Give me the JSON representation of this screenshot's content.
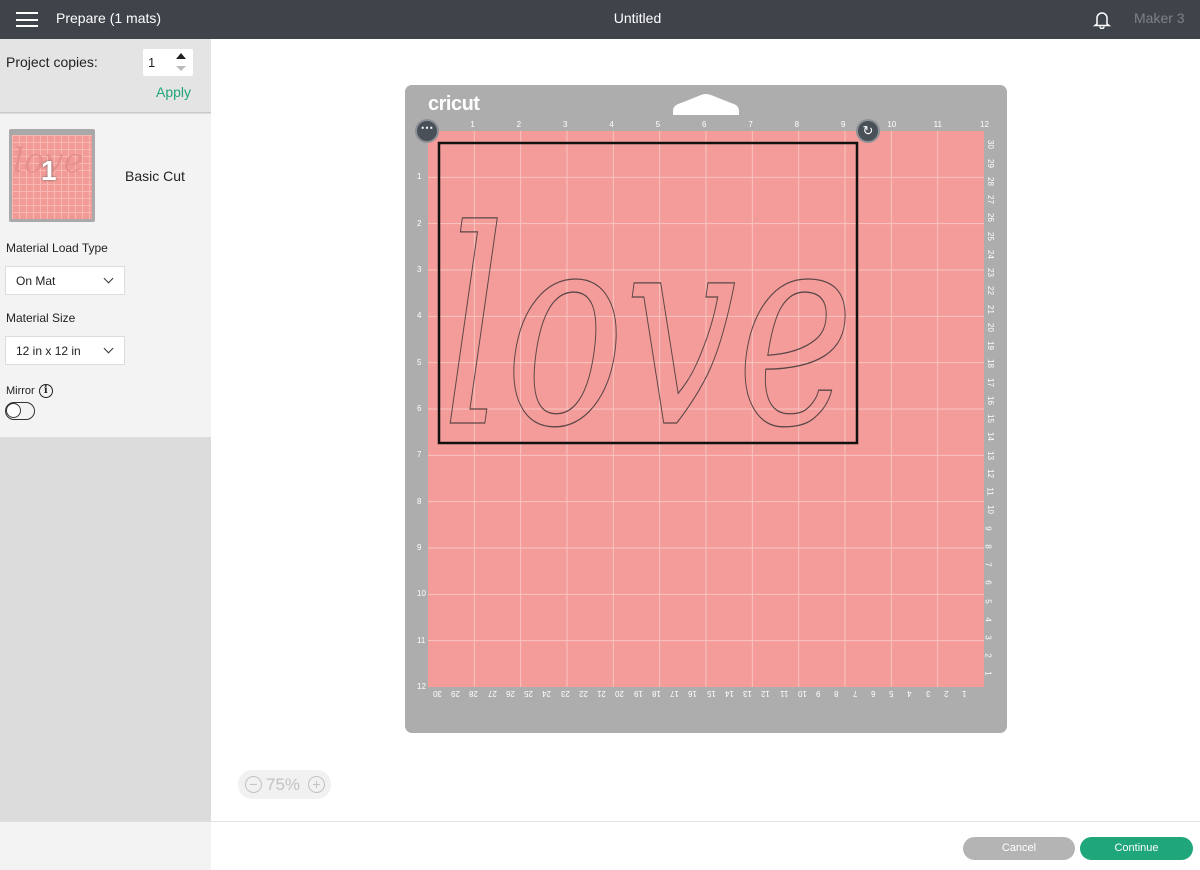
{
  "header": {
    "title": "Prepare (1 mats)",
    "document": "Untitled",
    "machine": "Maker 3",
    "icons": [
      "menu-icon",
      "bell-icon"
    ]
  },
  "sidebar": {
    "copies_label": "Project copies:",
    "copies_value": "1",
    "apply_label": "Apply",
    "mat": {
      "number": "1",
      "thumbnail_text": "love",
      "name": "Basic Cut"
    },
    "load_type_label": "Material Load Type",
    "load_type_value": "On Mat",
    "size_label": "Material Size",
    "size_value": "12 in x 12 in",
    "mirror_label": "Mirror",
    "mirror_on": false
  },
  "mat": {
    "brand": "cricut",
    "color": "#f39c99",
    "design_text": "love",
    "top_ruler": [
      "1",
      "2",
      "3",
      "4",
      "5",
      "6",
      "7",
      "8",
      "9",
      "10",
      "11",
      "12"
    ],
    "left_ruler": [
      "1",
      "2",
      "3",
      "4",
      "5",
      "6",
      "7",
      "8",
      "9",
      "10",
      "11",
      "12"
    ],
    "right_ruler": [
      "30",
      "29",
      "28",
      "27",
      "26",
      "25",
      "24",
      "23",
      "22",
      "21",
      "20",
      "19",
      "18",
      "17",
      "16",
      "15",
      "14",
      "13",
      "12",
      "11",
      "10",
      "9",
      "8",
      "7",
      "6",
      "5",
      "4",
      "3",
      "2",
      "1"
    ],
    "bottom_ruler": [
      "30",
      "29",
      "28",
      "27",
      "26",
      "25",
      "24",
      "23",
      "22",
      "21",
      "20",
      "19",
      "18",
      "17",
      "16",
      "15",
      "14",
      "13",
      "12",
      "11",
      "10",
      "9",
      "8",
      "7",
      "6",
      "5",
      "4",
      "3",
      "2",
      "1"
    ]
  },
  "zoom": {
    "level": "75%"
  },
  "footer": {
    "cancel": "Cancel",
    "continue": "Continue"
  },
  "colors": {
    "accent": "#1fa67a",
    "topbar": "#3f444b"
  }
}
